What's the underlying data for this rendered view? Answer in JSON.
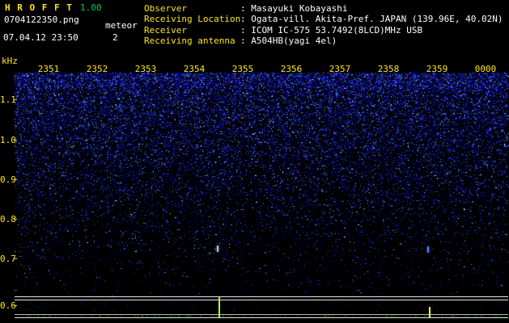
{
  "app": {
    "title": "H R O F F T",
    "version": "1.00",
    "filename": "0704122350.png",
    "mode_label": "meteor",
    "timestamp": "07.04.12 23:50",
    "meteor_count": "2"
  },
  "station": {
    "rows": [
      {
        "label": "Observer",
        "value": ": Masayuki Kobayashi"
      },
      {
        "label": "Receiving Location",
        "value": ": Ogata-vill. Akita-Pref. JAPAN (139.96E, 40.02N)"
      },
      {
        "label": "Receiver",
        "value": ": ICOM IC-575 53.7492(8LCD)MHz USB"
      },
      {
        "label": "Receiving antenna",
        "value": ": A504HB(yagi 4el)"
      }
    ]
  },
  "chart_data": {
    "type": "heatmap",
    "title": "HROFFT 10-minute meteor radio spectrogram 23:51-00:00",
    "ylabel": "kHz",
    "x_ticks": [
      "2351",
      "2352",
      "2353",
      "2354",
      "2355",
      "2356",
      "2357",
      "2358",
      "2359",
      "0000"
    ],
    "y_ticks": [
      "1.1",
      "1.0",
      "0.9",
      "0.8",
      "0.7",
      "0.6"
    ],
    "ylim": [
      0.55,
      1.15
    ],
    "x_range": [
      "23:51",
      "00:00"
    ],
    "grid": false,
    "meteor_echoes": [
      {
        "time": "23:55.6",
        "freq_khz": 0.72,
        "x": 268,
        "y": 304,
        "color": "#a8c4ff"
      },
      {
        "time": "23:59.5",
        "freq_khz": 0.72,
        "x": 528,
        "y": 305,
        "color": "#5577ee"
      }
    ],
    "signal_spikes": [
      {
        "time": "23:55.6",
        "x": 270,
        "height": 26,
        "color": "#b8ff2a"
      },
      {
        "time": "23:59.5",
        "x": 530,
        "height": 13,
        "color": "#ffff55"
      }
    ],
    "colors": {
      "background": "#000000",
      "noise_blue": "#2233cc",
      "axis_text": "#ffe41c",
      "value_text": "#ffffff",
      "version_text": "#00cc44",
      "baseline_green": "#009600"
    }
  }
}
